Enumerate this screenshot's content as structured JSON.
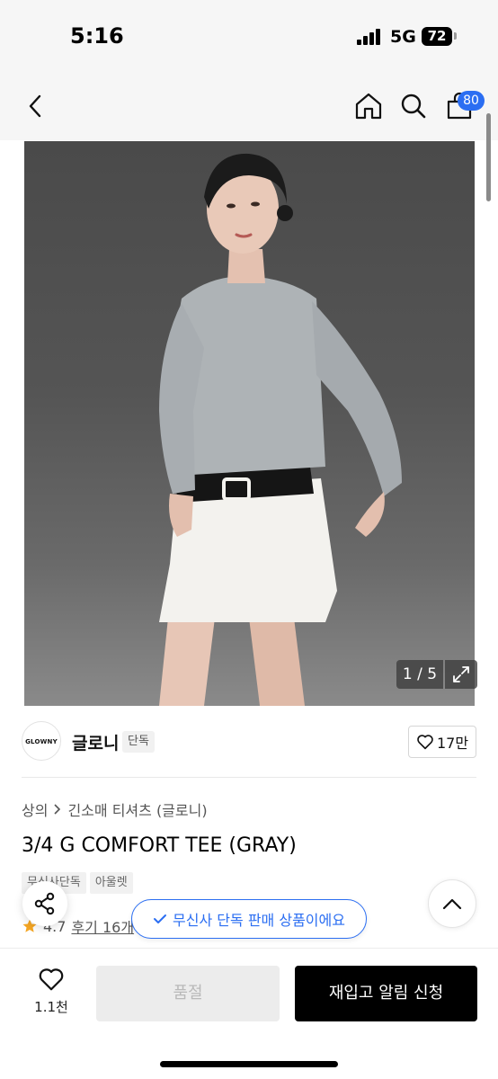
{
  "status_bar": {
    "time": "5:16",
    "network": "5G",
    "battery": "72"
  },
  "nav": {
    "cart_count": "80"
  },
  "gallery": {
    "counter": "1 / 5"
  },
  "brand": {
    "logo_text": "GLOWNY",
    "name": "글로니",
    "tag": "단독",
    "likes": "17만"
  },
  "product": {
    "breadcrumb": [
      "상의",
      "긴소매 티셔츠 (글로니)"
    ],
    "title": "3/4 G COMFORT TEE (GRAY)",
    "tags": [
      "무신사단독",
      "아울렛"
    ],
    "rating": "4.7",
    "reviews": "후기 16개"
  },
  "toast": {
    "text": "무신사 단독 판매 상품이에요"
  },
  "bottom_bar": {
    "wish_count": "1.1천",
    "soldout_label": "품절",
    "restock_label": "재입고 알림 신청"
  },
  "colors": {
    "accent": "#2b6ef2",
    "primary_button": "#000000",
    "disabled_button": "#ececec",
    "star": "#f5a623"
  },
  "icons": [
    "back-arrow-icon",
    "home-icon",
    "search-icon",
    "cart-icon",
    "expand-icon",
    "heart-icon",
    "check-icon",
    "share-icon",
    "chevron-up-icon",
    "star-icon",
    "chevron-right-icon"
  ]
}
